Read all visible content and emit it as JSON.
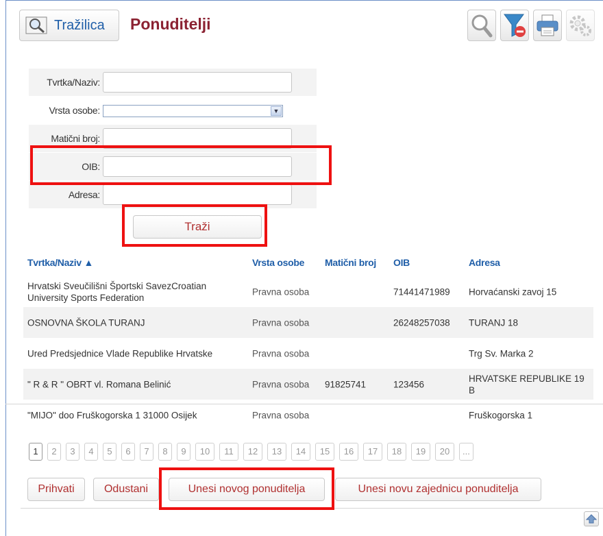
{
  "header": {
    "search_label": "Tražilica",
    "title": "Ponuditelji",
    "tools": [
      "search-icon",
      "filter-remove-icon",
      "printer-icon",
      "settings-gear-icon"
    ]
  },
  "form": {
    "fields": [
      {
        "label": "Tvrtka/Naziv:",
        "value": "",
        "type": "text"
      },
      {
        "label": "Vrsta osobe:",
        "value": "",
        "type": "select"
      },
      {
        "label": "Matični broj:",
        "value": "",
        "type": "text"
      },
      {
        "label": "OIB:",
        "value": "",
        "type": "text"
      },
      {
        "label": "Adresa:",
        "value": "",
        "type": "text"
      }
    ],
    "search_button": "Traži"
  },
  "table": {
    "columns": [
      "Tvrtka/Naziv ▲",
      "Vrsta osobe",
      "Matični broj",
      "OIB",
      "Adresa"
    ],
    "rows": [
      {
        "naziv": "Hrvatski Sveučilišni Športski SavezCroatian University Sports Federation",
        "vrsta": "Pravna osoba",
        "mb": "",
        "oib": "71441471989",
        "adresa": "Horvaćanski zavoj 15"
      },
      {
        "naziv": "OSNOVNA ŠKOLA TURANJ",
        "vrsta": "Pravna osoba",
        "mb": "",
        "oib": "26248257038",
        "adresa": "TURANJ 18"
      },
      {
        "naziv": "Ured Predsjednice Vlade Republike Hrvatske",
        "vrsta": "Pravna osoba",
        "mb": "",
        "oib": "",
        "adresa": "Trg Sv. Marka 2"
      },
      {
        "naziv": "\" R & R \" OBRT vl. Romana Belinić",
        "vrsta": "Pravna osoba",
        "mb": "91825741",
        "oib": "123456",
        "adresa": "HRVATSKE REPUBLIKE 19 B"
      },
      {
        "naziv": "\"MIJO\" doo Fruškogorska 1 31000 Osijek",
        "vrsta": "Pravna osoba",
        "mb": "",
        "oib": "",
        "adresa": "Fruškogorska 1"
      }
    ]
  },
  "pagination": {
    "pages": [
      "1",
      "2",
      "3",
      "4",
      "5",
      "6",
      "7",
      "8",
      "9",
      "10",
      "11",
      "12",
      "13",
      "14",
      "15",
      "16",
      "17",
      "18",
      "19",
      "20",
      "..."
    ],
    "active": "1"
  },
  "actions": {
    "accept": "Prihvati",
    "cancel": "Odustani",
    "new_bidder": "Unesi novog ponuditelja",
    "new_group": "Unesi novu zajednicu ponuditelja"
  },
  "colors": {
    "title": "#8b2232",
    "link": "#1f5ea8",
    "highlight": "#ee1111"
  }
}
